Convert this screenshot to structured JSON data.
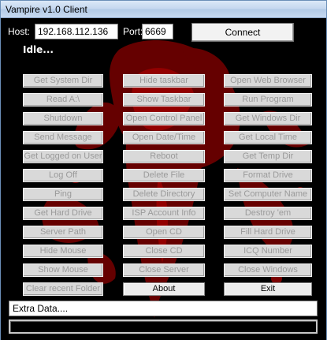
{
  "window": {
    "title": "Vampire v1.0 Client"
  },
  "connection": {
    "host_label": "Host:",
    "host_value": "192.168.112.136",
    "port_label": "Port:",
    "port_value": "6669",
    "connect_label": "Connect",
    "status": "Idle..."
  },
  "buttons": {
    "col1": [
      "Get System Dir",
      "Read A:\\",
      "Shutdown",
      "Send Message",
      "Get Logged on User",
      "Log Off",
      "Ping",
      "Get Hard Drive",
      "Server Path",
      "Hide Mouse",
      "Show Mouse",
      "Clear recent Folder"
    ],
    "col2": [
      "Hide taskbar",
      "Show Taskbar",
      "Open Control Panel",
      "Open Date/Time",
      "Reboot",
      "Delete File",
      "Delete Directory",
      "ISP Account Info",
      "Open CD",
      "Close CD",
      "Close Server",
      "About"
    ],
    "col3": [
      "Open Web Browser",
      "Run Program",
      "Get Windows Dir",
      "Get Local Time",
      "Get Temp Dir",
      "Format Drive",
      "Set Computer Name",
      "Destroy 'em",
      "Fill Hard Drive",
      "ICQ Number",
      "Close Windows",
      "Exit"
    ]
  },
  "extra": {
    "value": "Extra Data...."
  },
  "progress": {
    "value": 0
  },
  "colors": {
    "background": "#000000",
    "splatter": "#8b0000",
    "button_disabled_text": "#9a9a9a"
  }
}
